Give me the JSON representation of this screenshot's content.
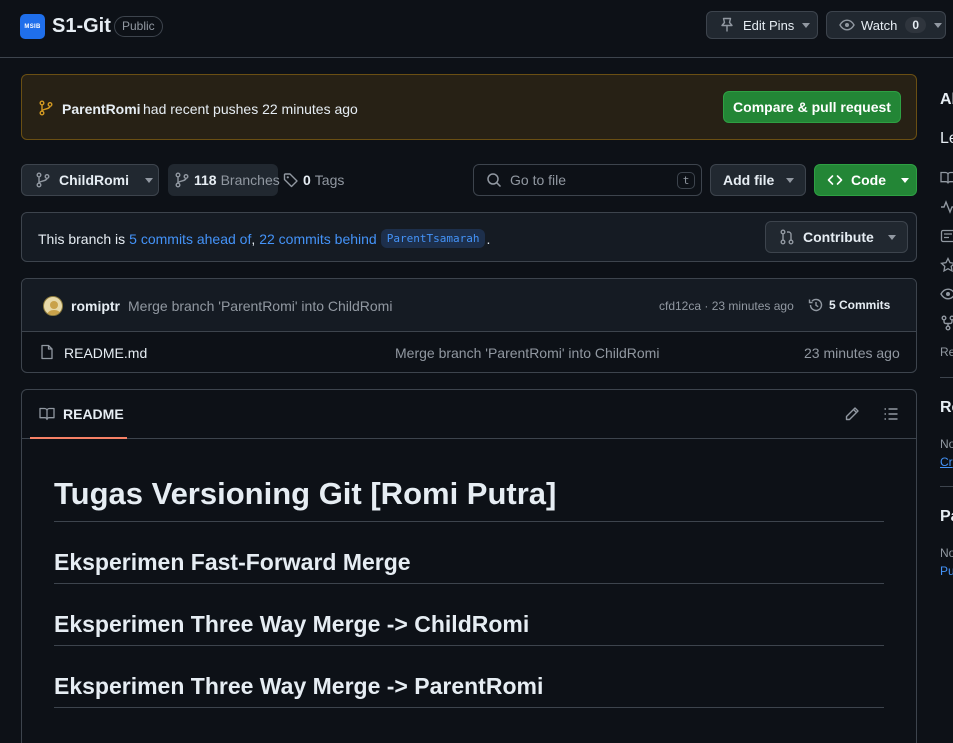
{
  "repo": {
    "logo_text": "MSIB",
    "name": "S1-Git",
    "visibility": "Public",
    "edit_pins_label": "Edit Pins",
    "watch_label": "Watch",
    "watch_count": "0"
  },
  "banner": {
    "branch": "ParentRomi",
    "message": "had recent pushes 22 minutes ago",
    "compare_button": "Compare & pull request"
  },
  "toolbar": {
    "current_branch": "ChildRomi",
    "branches_count": "118",
    "branches_label": "Branches",
    "tags_count": "0",
    "tags_label": "Tags",
    "search_placeholder": "Go to file",
    "search_shortcut": "t",
    "add_file_label": "Add file",
    "code_label": "Code"
  },
  "branch_status": {
    "prefix": "This branch is",
    "ahead": "5 commits ahead of",
    "separator": ",",
    "behind": "22 commits behind",
    "base_branch": "ParentTsamarah",
    "suffix": ".",
    "contribute_label": "Contribute"
  },
  "latest_commit": {
    "author": "romiptr",
    "message": "Merge branch 'ParentRomi' into ChildRomi",
    "hash": "cfd12ca",
    "dot": "·",
    "time": "23 minutes ago",
    "commits_label": "5 Commits"
  },
  "files": [
    {
      "name": "README.md",
      "message": "Merge branch 'ParentRomi' into ChildRomi",
      "time": "23 minutes ago"
    }
  ],
  "readme": {
    "tab_label": "README",
    "h1": "Tugas Versioning Git [Romi Putra]",
    "h2_items": [
      "Eksperimen Fast-Forward Merge",
      "Eksperimen Three Way Merge -> ChildRomi",
      "Eksperimen Three Way Merge -> ParentRomi"
    ]
  },
  "sidebar": {
    "about_title": "Ab",
    "about_desc": "Le",
    "releases_label": "Re",
    "releases_title": "Re",
    "releases_text": "No",
    "releases_link": "Cr",
    "packages_title": "Pa",
    "packages_text": "No",
    "packages_link": "Pu"
  },
  "colors": {
    "background": "#0d1117",
    "border": "#3d444d",
    "button": "#212830",
    "primary_green": "#238636",
    "link": "#4493f8",
    "banner_bg": "#272115",
    "banner_border": "#6a4f13",
    "tab_underline": "#f78166"
  }
}
